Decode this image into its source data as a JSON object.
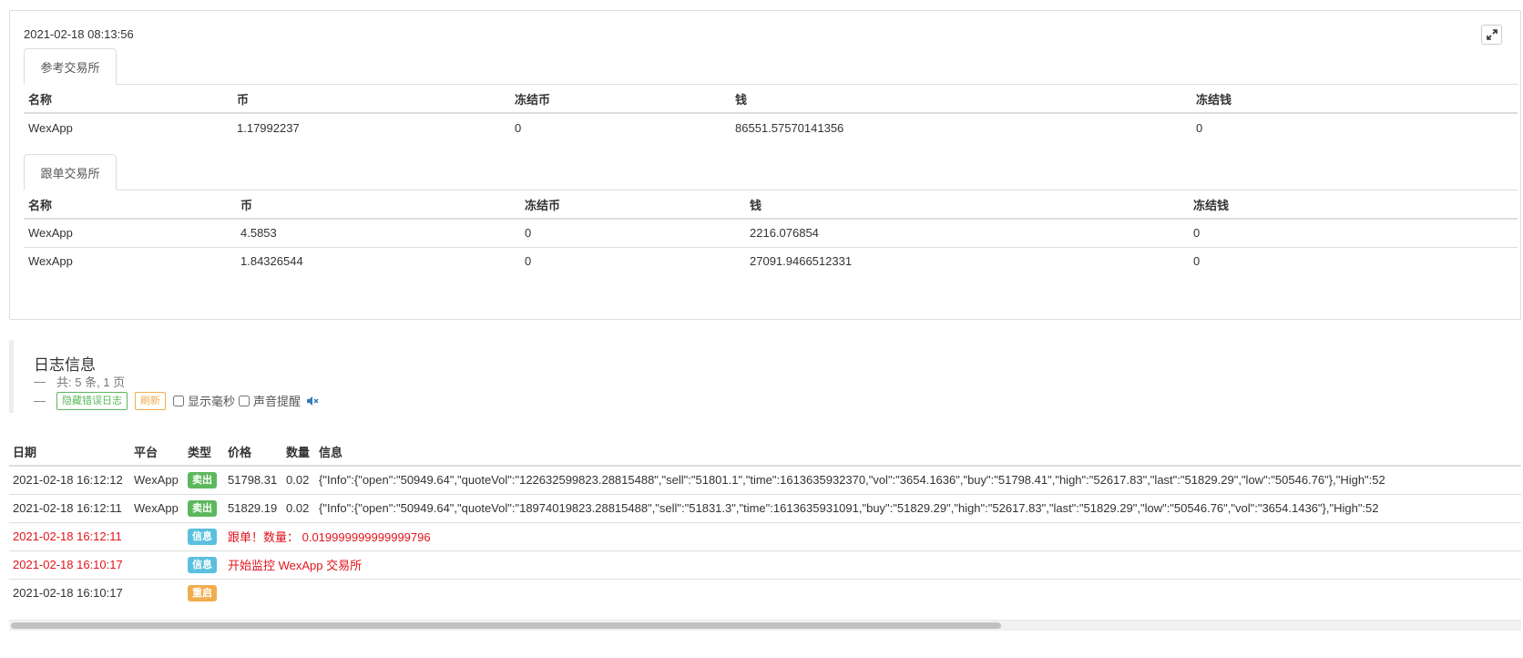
{
  "panel": {
    "timestamp": "2021-02-18 08:13:56",
    "ref_section": {
      "tab_label": "参考交易所",
      "columns": [
        "名称",
        "币",
        "冻结币",
        "钱",
        "冻结钱"
      ],
      "rows": [
        [
          "WexApp",
          "1.17992237",
          "0",
          "86551.57570141356",
          "0"
        ]
      ]
    },
    "follow_section": {
      "tab_label": "跟单交易所",
      "columns": [
        "名称",
        "币",
        "冻结币",
        "钱",
        "冻结钱"
      ],
      "rows": [
        [
          "WexApp",
          "4.5853",
          "0",
          "2216.076854",
          "0"
        ],
        [
          "WexApp",
          "1.84326544",
          "0",
          "27091.9466512331",
          "0"
        ]
      ]
    }
  },
  "log": {
    "title": "日志信息",
    "summary": "共: 5 条, 1 页",
    "hide_error_label": "隐藏错误日志",
    "refresh_label": "刷新",
    "show_ms_label": "显示毫秒",
    "sound_label": "声音提醒",
    "columns": [
      "日期",
      "平台",
      "类型",
      "价格",
      "数量",
      "信息"
    ],
    "rows": [
      {
        "date": "2021-02-18 16:12:12",
        "platform": "WexApp",
        "type": "卖出",
        "type_kind": "sell",
        "price": "51798.31",
        "amount": "0.02",
        "info": "{\"Info\":{\"open\":\"50949.64\",\"quoteVol\":\"122632599823.28815488\",\"sell\":\"51801.1\",\"time\":1613635932370,\"vol\":\"3654.1636\",\"buy\":\"51798.41\",\"high\":\"52617.83\",\"last\":\"51829.29\",\"low\":\"50546.76\"},\"High\":52",
        "red": false
      },
      {
        "date": "2021-02-18 16:12:11",
        "platform": "WexApp",
        "type": "卖出",
        "type_kind": "sell",
        "price": "51829.19",
        "amount": "0.02",
        "info": "{\"Info\":{\"open\":\"50949.64\",\"quoteVol\":\"18974019823.28815488\",\"sell\":\"51831.3\",\"time\":1613635931091,\"buy\":\"51829.29\",\"high\":\"52617.83\",\"last\":\"51829.29\",\"low\":\"50546.76\",\"vol\":\"3654.1436\"},\"High\":52",
        "red": false
      },
      {
        "date": "2021-02-18 16:12:11",
        "platform": "",
        "type": "信息",
        "type_kind": "info",
        "price": "跟单！数量： 0.019999999999999796",
        "amount": "",
        "info": "",
        "red": true
      },
      {
        "date": "2021-02-18 16:10:17",
        "platform": "",
        "type": "信息",
        "type_kind": "info",
        "price": "开始监控 WexApp 交易所",
        "amount": "",
        "info": "",
        "red": true
      },
      {
        "date": "2021-02-18 16:10:17",
        "platform": "",
        "type": "重启",
        "type_kind": "restart",
        "price": "",
        "amount": "",
        "info": "",
        "red": false
      }
    ]
  },
  "scrollbar": {
    "visible_fraction": 0.655
  }
}
